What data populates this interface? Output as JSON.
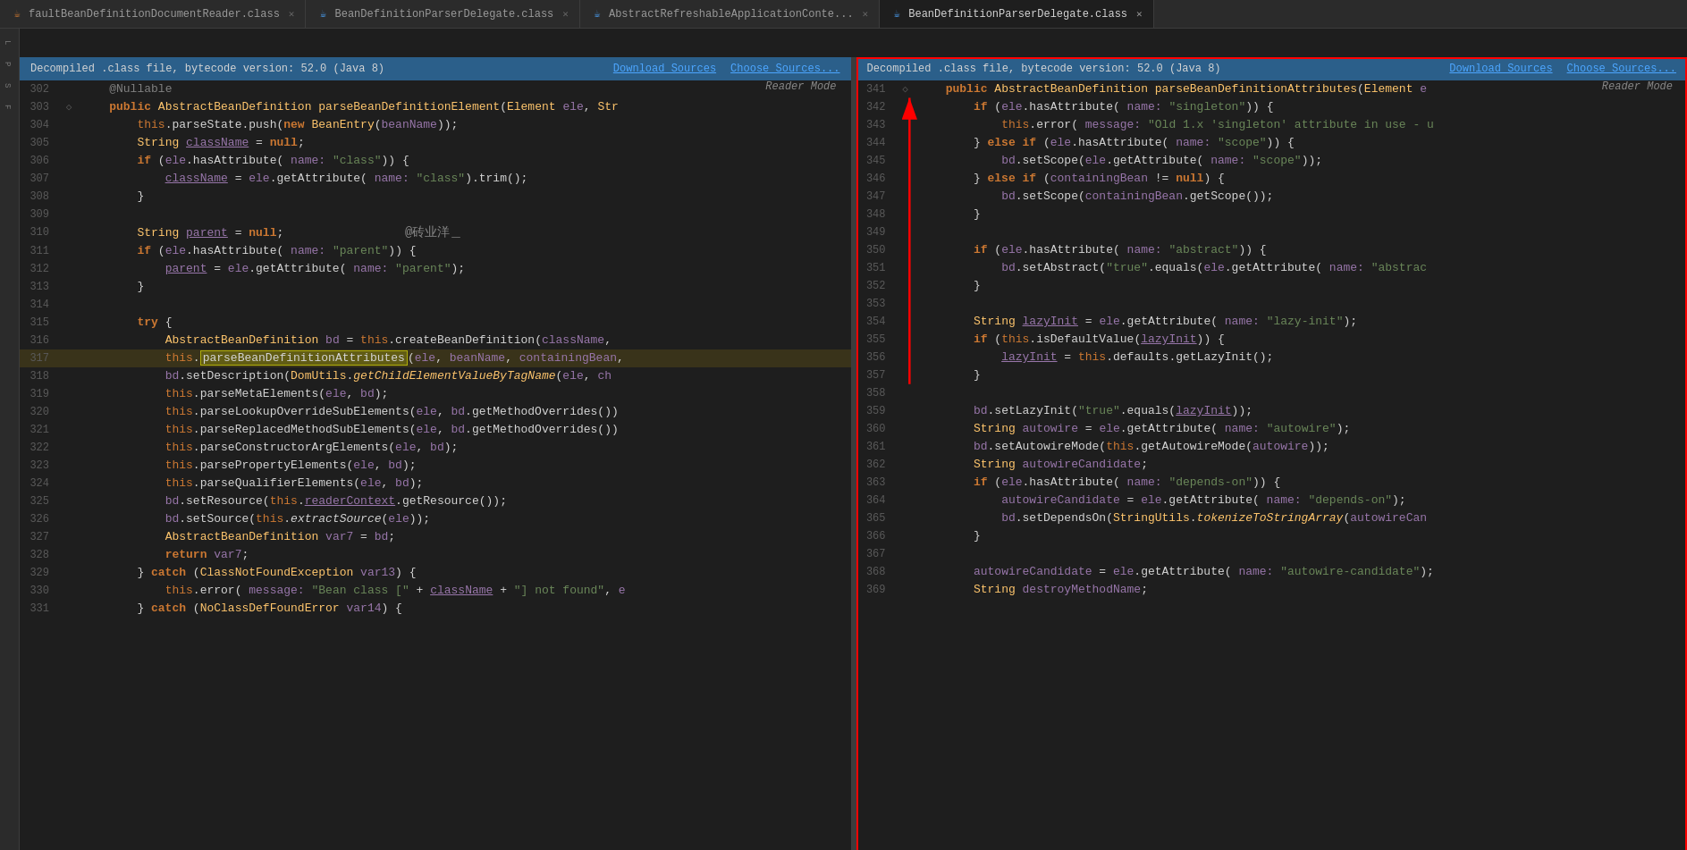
{
  "tabs": [
    {
      "id": "tab1",
      "label": "faultBeanDefinitionDocumentReader.class",
      "icon": "java-icon",
      "active": false,
      "color": "#cc7832"
    },
    {
      "id": "tab2",
      "label": "BeanDefinitionParserDelegate.class",
      "icon": "java-icon",
      "active": false,
      "color": "#4da6ff"
    },
    {
      "id": "tab3",
      "label": "AbstractRefreshableApplicationContext...",
      "icon": "java-icon",
      "active": false,
      "color": "#4da6ff"
    },
    {
      "id": "tab4",
      "label": "BeanDefinitionParserDelegate.class",
      "icon": "java-icon",
      "active": true,
      "color": "#4da6ff"
    }
  ],
  "left_pane": {
    "info_bar": {
      "text": "Decompiled .class file, bytecode version: 52.0 (Java 8)",
      "download_sources": "Download Sources",
      "choose_sources": "Choose Sources..."
    },
    "reader_mode": "Reader Mode",
    "lines": []
  },
  "right_pane": {
    "info_bar": {
      "text": "Decompiled .class file, bytecode version: 52.0 (Java 8)",
      "download_sources": "Download Sources",
      "choose_sources": "Choose Sources..."
    },
    "reader_mode": "Reader Mode"
  },
  "watermark": "@砖业洋＿"
}
